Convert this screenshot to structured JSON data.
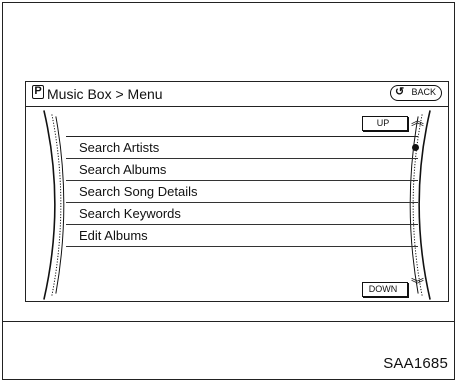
{
  "header": {
    "source_icon_glyph": "P",
    "breadcrumb": "Music Box > Menu",
    "back_label": "BACK"
  },
  "list": {
    "up_label": "UP",
    "down_label": "DOWN",
    "items": [
      {
        "label": "Search Artists"
      },
      {
        "label": "Search Albums"
      },
      {
        "label": "Search Song Details"
      },
      {
        "label": "Search Keywords"
      },
      {
        "label": "Edit Albums"
      }
    ]
  },
  "figure_code": "SAA1685",
  "icons": {
    "source": "source-p-icon",
    "back": "back-arrow-icon",
    "scroll_up": "double-chevron-up-icon",
    "scroll_down": "double-chevron-down-icon",
    "scroll_position": "scroll-position-dot-icon"
  }
}
